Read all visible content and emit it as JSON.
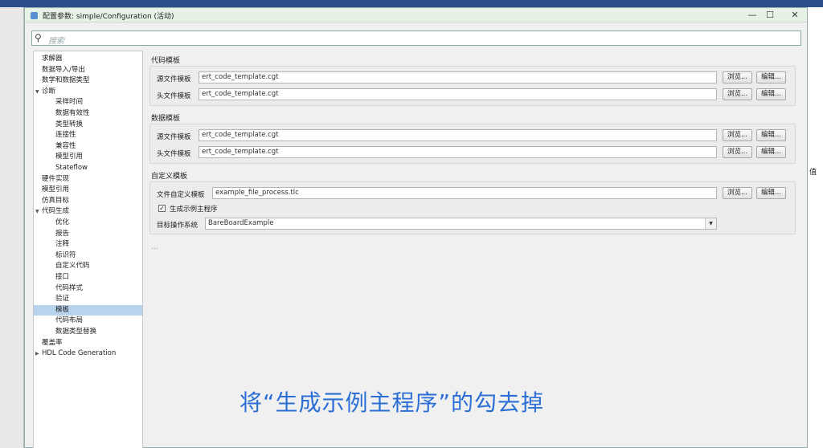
{
  "dialog": {
    "title": "配置参数: simple/Configuration (活动)",
    "minimize": "—",
    "maximize": "☐",
    "close": "✕"
  },
  "search": {
    "placeholder": "搜索"
  },
  "tree": [
    {
      "label": "求解器",
      "level": 0,
      "arrow": ""
    },
    {
      "label": "数据导入/导出",
      "level": 0,
      "arrow": ""
    },
    {
      "label": "数学和数据类型",
      "level": 0,
      "arrow": ""
    },
    {
      "label": "诊断",
      "level": 0,
      "arrow": "▼"
    },
    {
      "label": "采样时间",
      "level": 1,
      "arrow": ""
    },
    {
      "label": "数据有效性",
      "level": 1,
      "arrow": ""
    },
    {
      "label": "类型转换",
      "level": 1,
      "arrow": ""
    },
    {
      "label": "连接性",
      "level": 1,
      "arrow": ""
    },
    {
      "label": "兼容性",
      "level": 1,
      "arrow": ""
    },
    {
      "label": "模型引用",
      "level": 1,
      "arrow": ""
    },
    {
      "label": "Stateflow",
      "level": 1,
      "arrow": ""
    },
    {
      "label": "硬件实现",
      "level": 0,
      "arrow": ""
    },
    {
      "label": "模型引用",
      "level": 0,
      "arrow": ""
    },
    {
      "label": "仿真目标",
      "level": 0,
      "arrow": ""
    },
    {
      "label": "代码生成",
      "level": 0,
      "arrow": "▼"
    },
    {
      "label": "优化",
      "level": 1,
      "arrow": ""
    },
    {
      "label": "报告",
      "level": 1,
      "arrow": ""
    },
    {
      "label": "注释",
      "level": 1,
      "arrow": ""
    },
    {
      "label": "标识符",
      "level": 1,
      "arrow": ""
    },
    {
      "label": "自定义代码",
      "level": 1,
      "arrow": ""
    },
    {
      "label": "接口",
      "level": 1,
      "arrow": ""
    },
    {
      "label": "代码样式",
      "level": 1,
      "arrow": ""
    },
    {
      "label": "验证",
      "level": 1,
      "arrow": ""
    },
    {
      "label": "模板",
      "level": 1,
      "arrow": "",
      "selected": true
    },
    {
      "label": "代码布局",
      "level": 1,
      "arrow": ""
    },
    {
      "label": "数据类型替换",
      "level": 1,
      "arrow": ""
    },
    {
      "label": "覆盖率",
      "level": 0,
      "arrow": ""
    },
    {
      "label": "HDL Code Generation",
      "level": 0,
      "arrow": "▶"
    }
  ],
  "code_templates": {
    "title": "代码模板",
    "source_label": "源文件模板",
    "source_value": "ert_code_template.cgt",
    "header_label": "头文件模板",
    "header_value": "ert_code_template.cgt"
  },
  "data_templates": {
    "title": "数据模板",
    "source_label": "源文件模板",
    "source_value": "ert_code_template.cgt",
    "header_label": "头文件模板",
    "header_value": "ert_code_template.cgt"
  },
  "custom_templates": {
    "title": "自定义模板",
    "file_label": "文件自定义模板",
    "file_value": "example_file_process.tlc",
    "checkbox_label": "生成示例主程序",
    "checkbox_mark": "✓",
    "os_label": "目标操作系统",
    "os_value": "BareBoardExample"
  },
  "buttons": {
    "browse": "浏览...",
    "edit": "编辑..."
  },
  "more": "...",
  "caption": "将“生成示例主程序”的勾去掉",
  "right_pane": {
    "header": "值"
  }
}
